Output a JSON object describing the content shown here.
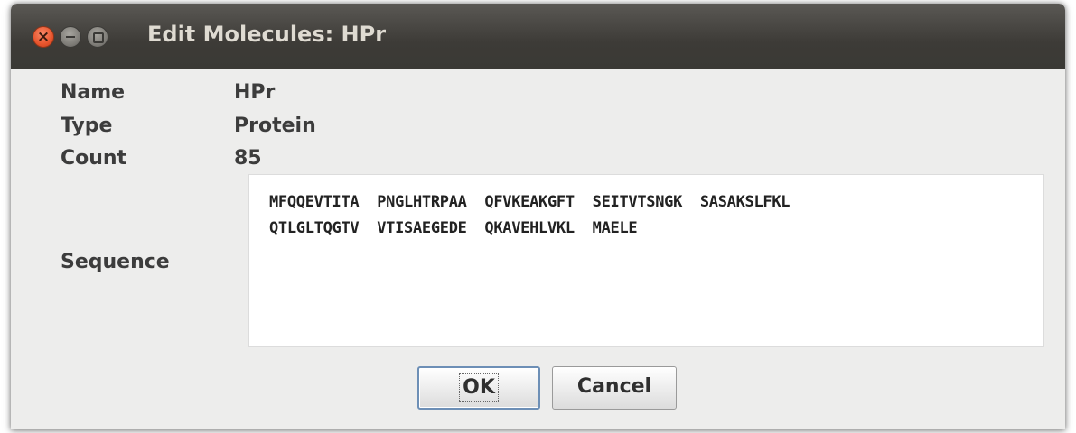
{
  "window": {
    "title": "Edit Molecules: HPr"
  },
  "fields": {
    "name_label": "Name",
    "name_value": "HPr",
    "type_label": "Type",
    "type_value": "Protein",
    "count_label": "Count",
    "count_value": "85",
    "sequence_label": "Sequence",
    "sequence_lines": [
      "MFQQEVTITA  PNGLHTRPAA  QFVKEAKGFT  SEITVTSNGK  SASAKSLFKL",
      "QTLGLTQGTV  VTISAEGEDE  QKAVEHLVKL  MAELE"
    ]
  },
  "buttons": {
    "ok_label": "OK",
    "cancel_label": "Cancel"
  },
  "icons": {
    "close": "close-icon",
    "minimize": "minimize-icon",
    "maximize": "maximize-icon"
  },
  "colors": {
    "titlebar": "#3d3b37",
    "close_button": "#e8552d",
    "dialog_background": "#ededec",
    "ok_border": "#6d8fb6"
  }
}
